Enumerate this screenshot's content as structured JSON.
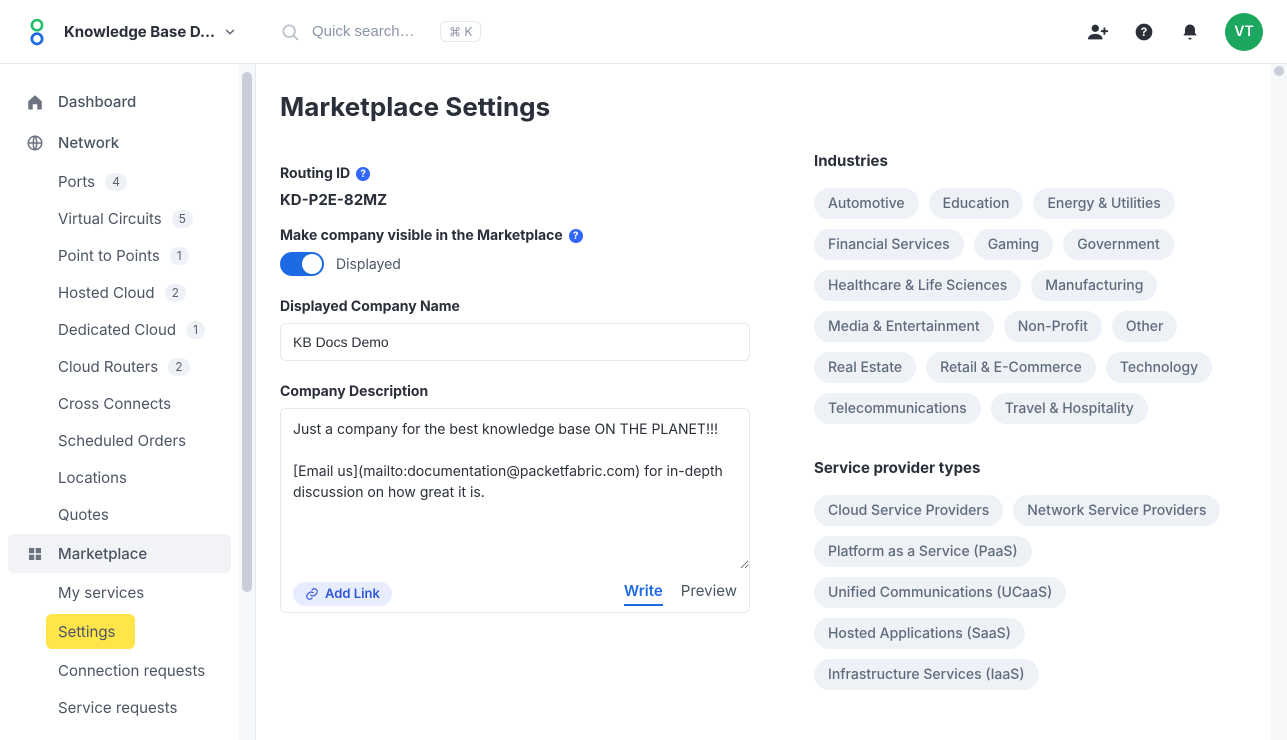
{
  "header": {
    "workspace_name": "Knowledge Base D…",
    "search_placeholder": "Quick search…",
    "shortcut_hint": "⌘ K",
    "avatar_initials": "VT"
  },
  "sidebar": {
    "dashboard": "Dashboard",
    "network": "Network",
    "network_items": [
      {
        "label": "Ports",
        "count": "4"
      },
      {
        "label": "Virtual Circuits",
        "count": "5"
      },
      {
        "label": "Point to Points",
        "count": "1"
      },
      {
        "label": "Hosted Cloud",
        "count": "2"
      },
      {
        "label": "Dedicated Cloud",
        "count": "1"
      },
      {
        "label": "Cloud Routers",
        "count": "2"
      },
      {
        "label": "Cross Connects"
      },
      {
        "label": "Scheduled Orders"
      },
      {
        "label": "Locations"
      },
      {
        "label": "Quotes"
      }
    ],
    "marketplace": "Marketplace",
    "marketplace_items": [
      {
        "label": "My services"
      },
      {
        "label": "Settings",
        "highlight": true
      },
      {
        "label": "Connection requests"
      },
      {
        "label": "Service requests"
      }
    ]
  },
  "main": {
    "title": "Marketplace Settings",
    "routing_id_label": "Routing ID",
    "routing_id_value": "KD-P2E-82MZ",
    "visibility_label": "Make company visible in the Marketplace",
    "visibility_state": "Displayed",
    "company_name_label": "Displayed Company Name",
    "company_name_value": "KB Docs Demo",
    "description_label": "Company Description",
    "description_value": "Just a company for the best knowledge base ON THE PLANET!!!\n\n[Email us](mailto:documentation@packetfabric.com) for in-depth discussion on how great it is.",
    "add_link_label": "Add Link",
    "tab_write": "Write",
    "tab_preview": "Preview",
    "industries_title": "Industries",
    "industries": [
      "Automotive",
      "Education",
      "Energy & Utilities",
      "Financial Services",
      "Gaming",
      "Government",
      "Healthcare & Life Sciences",
      "Manufacturing",
      "Media & Entertainment",
      "Non-Profit",
      "Other",
      "Real Estate",
      "Retail & E-Commerce",
      "Technology",
      "Telecommunications",
      "Travel & Hospitality"
    ],
    "spt_title": "Service provider types",
    "service_provider_types": [
      "Cloud Service Providers",
      "Network Service Providers",
      "Platform as a Service (PaaS)",
      "Unified Communications (UCaaS)",
      "Hosted Applications (SaaS)",
      "Infrastructure Services (IaaS)"
    ]
  }
}
